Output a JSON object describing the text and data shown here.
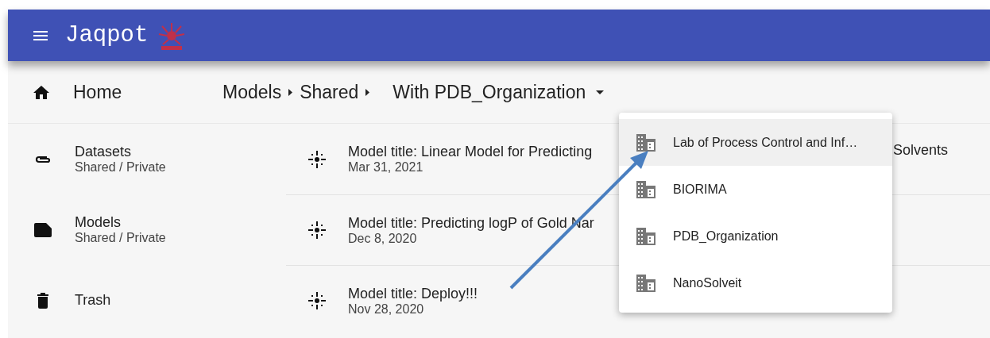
{
  "app_bar": {
    "title": "Jaqpot"
  },
  "breadcrumb": {
    "home": "Home",
    "items": [
      "Models",
      "Shared"
    ],
    "current": "With PDB_Organization"
  },
  "sidebar": {
    "items": [
      {
        "kind": "datasets",
        "label": "Datasets",
        "sublabel": "Shared / Private"
      },
      {
        "kind": "models",
        "label": "Models",
        "sublabel": "Shared / Private"
      },
      {
        "kind": "trash",
        "label": "Trash"
      }
    ]
  },
  "models": [
    {
      "title": "Model title: Linear Model for Predicting",
      "title_tail": "Solvents",
      "date": "Mar 31, 2021"
    },
    {
      "title": "Model title: Predicting logP of Gold Nar",
      "date": "Dec 8, 2020"
    },
    {
      "title": "Model title: Deploy!!!",
      "date": "Nov 28, 2020"
    }
  ],
  "organization_menu": {
    "items": [
      {
        "label": "Lab of Process Control and Inf…",
        "selected": true
      },
      {
        "label": "BIORIMA",
        "selected": false
      },
      {
        "label": "PDB_Organization",
        "selected": false
      },
      {
        "label": "NanoSolveit",
        "selected": false
      }
    ]
  },
  "annotation": {
    "kind": "arrow"
  }
}
